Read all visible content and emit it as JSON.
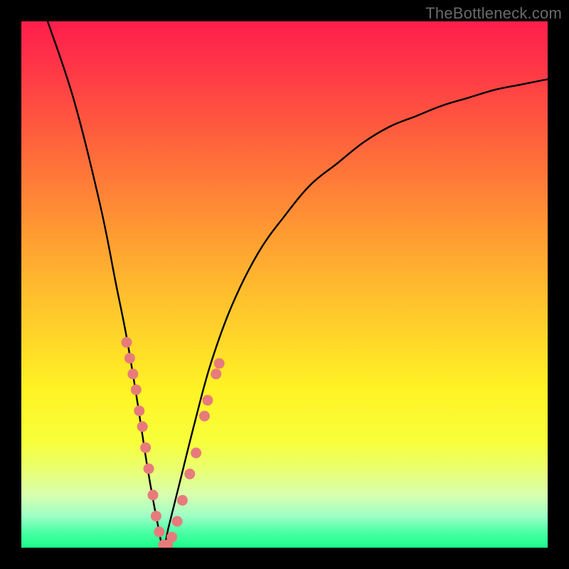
{
  "watermark": "TheBottleneck.com",
  "colors": {
    "frame": "#000000",
    "curve": "#000000",
    "dot": "#e77b7b",
    "gradient_top": "#ff1e4c",
    "gradient_bottom": "#1aff8b"
  },
  "chart_data": {
    "type": "line",
    "title": "",
    "xlabel": "",
    "ylabel": "",
    "xlim": [
      0,
      100
    ],
    "ylim": [
      0,
      100
    ],
    "grid": false,
    "note": "V-shaped bottleneck curve on green-yellow-red vertical gradient. Minimum (0% bottleneck) near x≈27. Pink dots cluster along the curve near the trough on both sides, roughly in the 25–40% bottleneck band.",
    "series": [
      {
        "name": "bottleneck-curve",
        "x": [
          5,
          10,
          15,
          18,
          20,
          22,
          24,
          26,
          27,
          28,
          30,
          33,
          36,
          40,
          45,
          50,
          55,
          60,
          65,
          70,
          75,
          80,
          85,
          90,
          95,
          100
        ],
        "y": [
          100,
          85,
          65,
          50,
          40,
          28,
          15,
          4,
          0,
          4,
          12,
          24,
          35,
          46,
          56,
          63,
          69,
          73,
          77,
          80,
          82,
          84,
          85.5,
          87,
          88,
          89
        ]
      }
    ],
    "dots": [
      {
        "x": 20.0,
        "y": 39
      },
      {
        "x": 20.6,
        "y": 36
      },
      {
        "x": 21.2,
        "y": 33
      },
      {
        "x": 21.8,
        "y": 30
      },
      {
        "x": 22.4,
        "y": 26
      },
      {
        "x": 23.0,
        "y": 23
      },
      {
        "x": 23.6,
        "y": 19
      },
      {
        "x": 24.2,
        "y": 15
      },
      {
        "x": 25.0,
        "y": 10
      },
      {
        "x": 25.6,
        "y": 6
      },
      {
        "x": 26.2,
        "y": 3
      },
      {
        "x": 27.0,
        "y": 0.5
      },
      {
        "x": 27.8,
        "y": 0.5
      },
      {
        "x": 28.6,
        "y": 2
      },
      {
        "x": 29.6,
        "y": 5
      },
      {
        "x": 30.6,
        "y": 9
      },
      {
        "x": 32.0,
        "y": 14
      },
      {
        "x": 33.2,
        "y": 18
      },
      {
        "x": 34.8,
        "y": 25
      },
      {
        "x": 35.4,
        "y": 28
      },
      {
        "x": 37.0,
        "y": 33
      },
      {
        "x": 37.6,
        "y": 35
      }
    ]
  }
}
